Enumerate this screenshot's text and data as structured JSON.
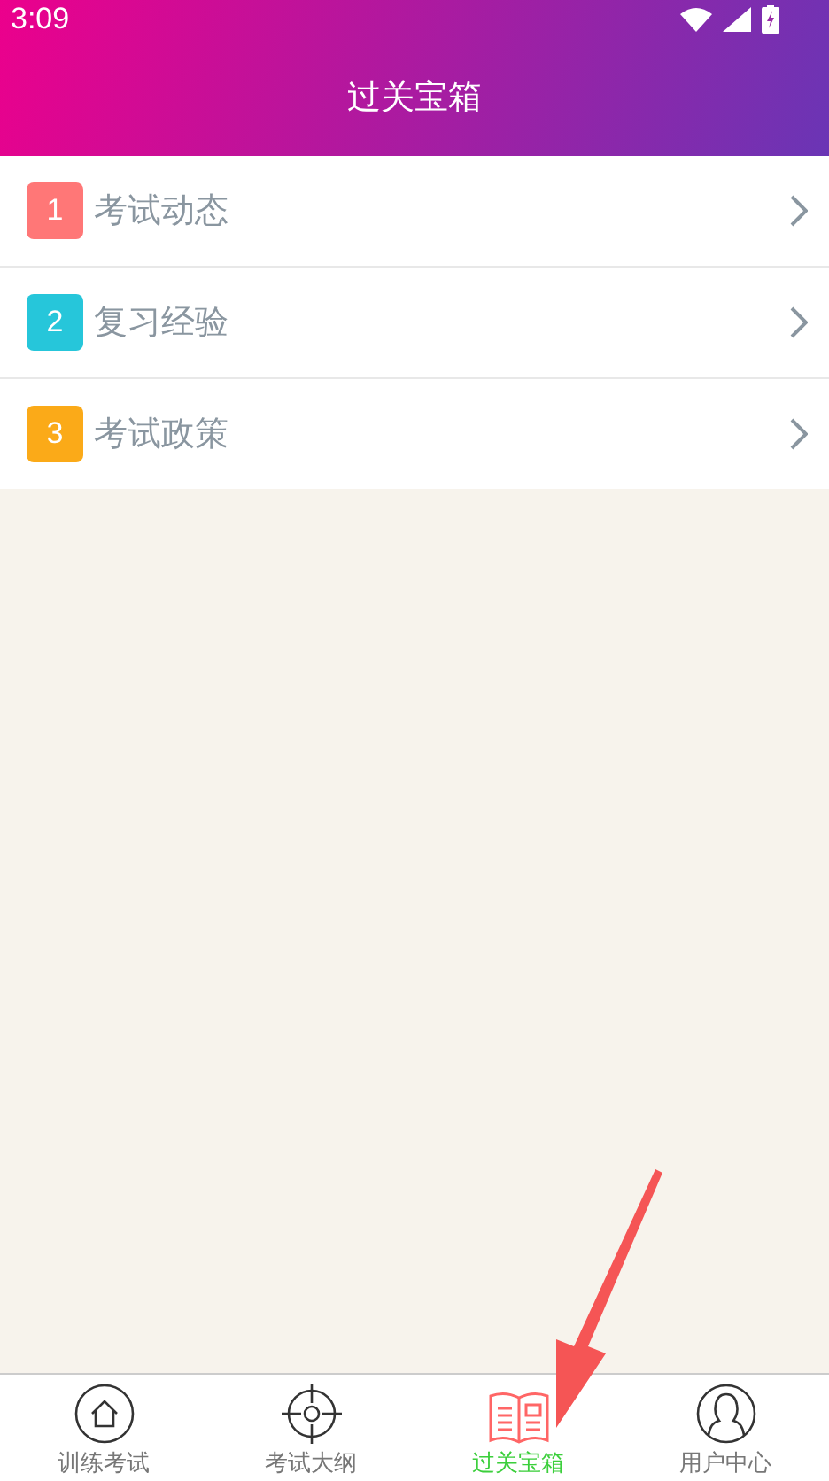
{
  "status_bar": {
    "time": "3:09"
  },
  "header": {
    "title": "过关宝箱"
  },
  "list": [
    {
      "number": "1",
      "label": "考试动态",
      "color": "#ff7777"
    },
    {
      "number": "2",
      "label": "复习经验",
      "color": "#26c6da"
    },
    {
      "number": "3",
      "label": "考试政策",
      "color": "#fbaa18"
    }
  ],
  "tabs": [
    {
      "label": "训练考试",
      "kind": "home",
      "selected": false
    },
    {
      "label": "考试大纲",
      "kind": "target",
      "selected": false
    },
    {
      "label": "过关宝箱",
      "kind": "book",
      "selected": true
    },
    {
      "label": "用户中心",
      "kind": "user",
      "selected": false
    }
  ]
}
